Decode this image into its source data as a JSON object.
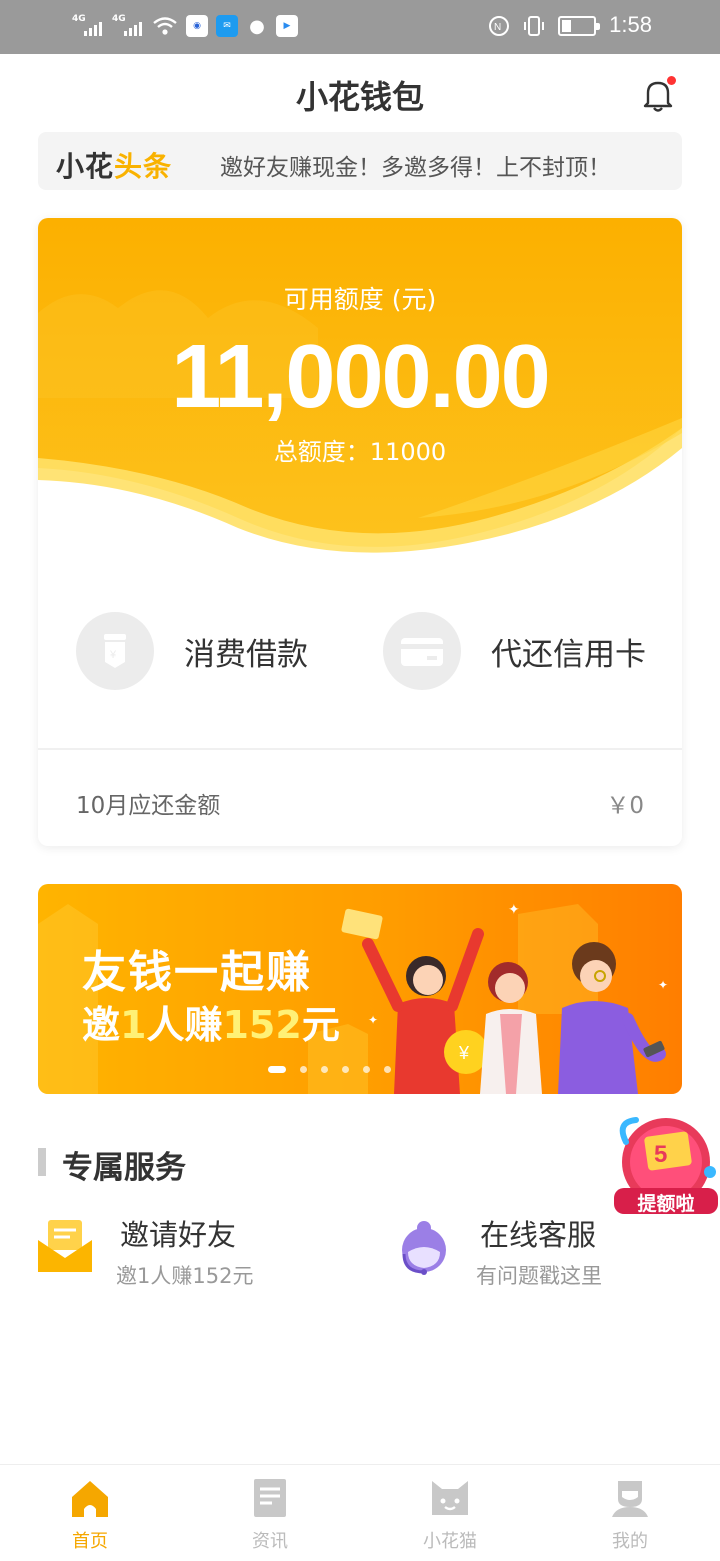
{
  "status_bar": {
    "network_1": "4G",
    "network_2": "4G",
    "time": "1:58",
    "app_icons": [
      "baidu-icon",
      "message-icon",
      "chat-icon",
      "youku-icon"
    ],
    "battery_level": 0.3
  },
  "header": {
    "title": "小花钱包",
    "has_notification": true
  },
  "news": {
    "logo_part1": "小花",
    "logo_part2": "头条",
    "text": "邀好友赚现金！多邀多得！上不封顶！"
  },
  "credit": {
    "available_label": "可用额度 (元)",
    "available_amount": "11,000.00",
    "total_label": "总额度：11000"
  },
  "actions": [
    {
      "label": "消费借款",
      "icon": "yen-pouch-icon"
    },
    {
      "label": "代还信用卡",
      "icon": "credit-card-icon"
    }
  ],
  "due": {
    "label": "10月应还金额",
    "value": "￥0"
  },
  "banner": {
    "line1": "友钱一起赚",
    "line2_pre": "邀",
    "line2_num1": "1",
    "line2_mid": "人赚",
    "line2_num2": "152",
    "line2_post": "元",
    "slides": 6,
    "active_slide": 0
  },
  "section": {
    "title": "专属服务"
  },
  "services": [
    {
      "title": "邀请好友",
      "sub": "邀1人赚152元",
      "icon": "envelope-icon"
    },
    {
      "title": "在线客服",
      "sub": "有问题戳这里",
      "icon": "customer-service-icon"
    }
  ],
  "float_badge": {
    "label": "提额啦"
  },
  "tabs": [
    {
      "label": "首页",
      "icon": "home-icon",
      "active": true
    },
    {
      "label": "资讯",
      "icon": "news-icon",
      "active": false
    },
    {
      "label": "小花猫",
      "icon": "cat-icon",
      "active": false
    },
    {
      "label": "我的",
      "icon": "profile-icon",
      "active": false
    }
  ],
  "colors": {
    "accent": "#f9b200",
    "tab_active": "#f5a700",
    "tab_inactive": "#bbbbbb"
  }
}
